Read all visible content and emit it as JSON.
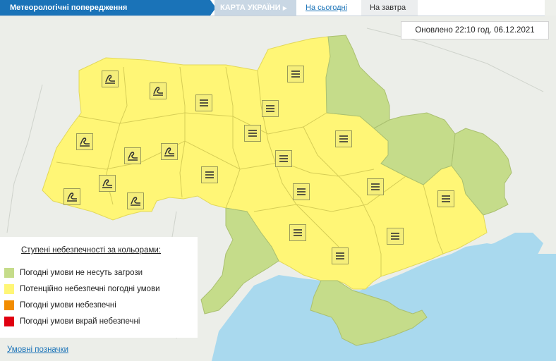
{
  "header": {
    "title": "Метеорологічні попередження",
    "tab_map": "КАРТА УКРАЇНИ",
    "tab_today": "На сьогодні",
    "tab_tomorrow": "На завтра"
  },
  "updated": "Оновлено 22:10 год. 06.12.2021",
  "legend": {
    "title": "Ступені небезпечності за кольорами:",
    "items": [
      {
        "label": "Погодні умови не несуть загрози",
        "color": "#c5dc8a"
      },
      {
        "label": "Потенційно небезпечні погодні умови",
        "color": "#fff676"
      },
      {
        "label": "Погодні умови небезпечні",
        "color": "#f28c00"
      },
      {
        "label": "Погодні умови вкрай небезпечні",
        "color": "#e00010"
      }
    ]
  },
  "symbols_link": "Умовні позначки",
  "colors": {
    "accent": "#1a73b8",
    "yellow_region": "#fff676",
    "green_region": "#c5dc8a",
    "sea": "#a9d9ee",
    "neighbor": "#e7eae3"
  },
  "icons": {
    "wind": "wind-icon",
    "fog": "fog-icon"
  }
}
